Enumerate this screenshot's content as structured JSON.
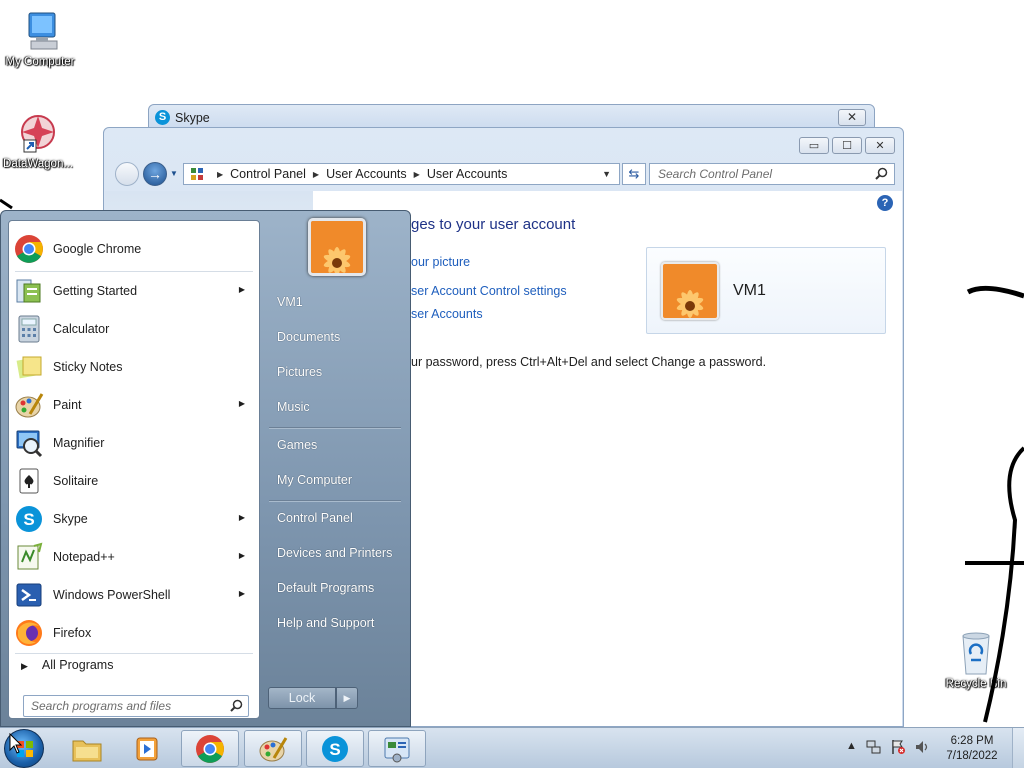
{
  "desktop": {
    "icons": [
      {
        "label": "My Computer",
        "icon": "my-computer-icon"
      },
      {
        "label": "DataWagon...",
        "icon": "datawagon-icon"
      },
      {
        "label": "Recycle Bin",
        "icon": "recycle-bin-icon"
      }
    ]
  },
  "skype_window": {
    "title": "Skype",
    "close": "✕"
  },
  "control_panel": {
    "window_buttons": {
      "minimize": "▭",
      "maximize": "☐",
      "close": "✕"
    },
    "breadcrumb": [
      "Control Panel",
      "User Accounts",
      "User Accounts"
    ],
    "search_placeholder": "Search Control Panel",
    "heading": "ges to your user account",
    "links": [
      "our picture",
      "ser Account Control settings",
      "ser Accounts"
    ],
    "note": "ur password, press Ctrl+Alt+Del and select Change a password.",
    "user_card": {
      "name": "VM1"
    },
    "help": "?"
  },
  "start_menu": {
    "programs": [
      {
        "label": "Google Chrome",
        "icon": "chrome-icon",
        "has_submenu": false
      },
      {
        "label": "Getting Started",
        "icon": "getting-started-icon",
        "has_submenu": true
      },
      {
        "label": "Calculator",
        "icon": "calculator-icon",
        "has_submenu": false
      },
      {
        "label": "Sticky Notes",
        "icon": "sticky-notes-icon",
        "has_submenu": false
      },
      {
        "label": "Paint",
        "icon": "paint-icon",
        "has_submenu": true
      },
      {
        "label": "Magnifier",
        "icon": "magnifier-icon",
        "has_submenu": false
      },
      {
        "label": "Solitaire",
        "icon": "solitaire-icon",
        "has_submenu": false
      },
      {
        "label": "Skype",
        "icon": "skype-icon",
        "has_submenu": true
      },
      {
        "label": "Notepad++",
        "icon": "notepad-plus-plus-icon",
        "has_submenu": true
      },
      {
        "label": "Windows PowerShell",
        "icon": "powershell-icon",
        "has_submenu": true
      },
      {
        "label": "Firefox",
        "icon": "firefox-icon",
        "has_submenu": false
      }
    ],
    "all_programs": "All Programs",
    "search_placeholder": "Search programs and files",
    "right_items": [
      "VM1",
      "Documents",
      "Pictures",
      "Music",
      "Games",
      "My Computer",
      "Control Panel",
      "Devices and Printers",
      "Default Programs",
      "Help and Support"
    ],
    "lock_label": "Lock"
  },
  "taskbar": {
    "items": [
      {
        "name": "explorer",
        "icon": "folder-icon",
        "open": false
      },
      {
        "name": "media-player",
        "icon": "media-player-icon",
        "open": false
      },
      {
        "name": "chrome",
        "icon": "chrome-icon",
        "open": true
      },
      {
        "name": "paint",
        "icon": "paint-icon",
        "open": true
      },
      {
        "name": "skype",
        "icon": "skype-icon",
        "open": true
      },
      {
        "name": "control-panel",
        "icon": "control-panel-icon",
        "open": true
      }
    ],
    "clock_time": "6:28 PM",
    "clock_date": "7/18/2022"
  }
}
